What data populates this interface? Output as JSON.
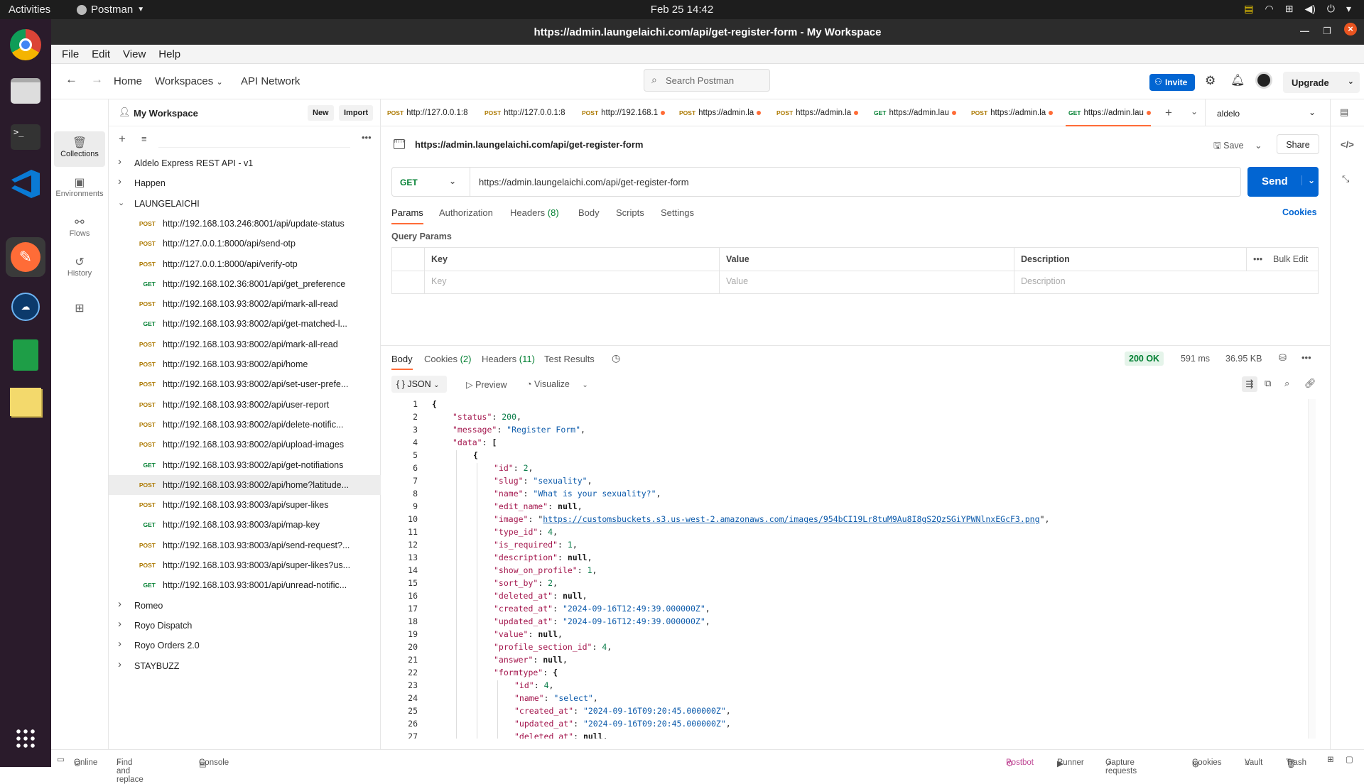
{
  "topbar": {
    "activities": "Activities",
    "app": "Postman",
    "clock": "Feb 25  14:42"
  },
  "window": {
    "title": "https://admin.laungelaichi.com/api/get-register-form - My Workspace"
  },
  "menu": [
    "File",
    "Edit",
    "View",
    "Help"
  ],
  "header": {
    "home": "Home",
    "workspaces": "Workspaces",
    "api_network": "API Network",
    "search_placeholder": "Search Postman",
    "invite": "Invite",
    "upgrade": "Upgrade"
  },
  "rail": [
    {
      "label": "Collections",
      "icon": "collections-icon"
    },
    {
      "label": "Environments",
      "icon": "environments-icon"
    },
    {
      "label": "Flows",
      "icon": "flows-icon"
    },
    {
      "label": "History",
      "icon": "history-icon"
    }
  ],
  "sidebar": {
    "workspace": "My Workspace",
    "new": "New",
    "import": "Import",
    "tree": [
      {
        "type": "folder",
        "name": "Aldelo Express REST API - v1",
        "open": false
      },
      {
        "type": "folder",
        "name": "Happen",
        "open": false
      },
      {
        "type": "folder",
        "name": "LAUNGELAICHI",
        "open": true
      },
      {
        "type": "req",
        "method": "POST",
        "url": "http://192.168.103.246:8001/api/update-status"
      },
      {
        "type": "req",
        "method": "POST",
        "url": "http://127.0.0.1:8000/api/send-otp"
      },
      {
        "type": "req",
        "method": "POST",
        "url": "http://127.0.0.1:8000/api/verify-otp"
      },
      {
        "type": "req",
        "method": "GET",
        "url": "http://192.168.102.36:8001/api/get_preference"
      },
      {
        "type": "req",
        "method": "POST",
        "url": "http://192.168.103.93:8002/api/mark-all-read"
      },
      {
        "type": "req",
        "method": "GET",
        "url": "http://192.168.103.93:8002/api/get-matched-l..."
      },
      {
        "type": "req",
        "method": "POST",
        "url": "http://192.168.103.93:8002/api/mark-all-read"
      },
      {
        "type": "req",
        "method": "POST",
        "url": "http://192.168.103.93:8002/api/home"
      },
      {
        "type": "req",
        "method": "POST",
        "url": "http://192.168.103.93:8002/api/set-user-prefe..."
      },
      {
        "type": "req",
        "method": "POST",
        "url": "http://192.168.103.93:8002/api/user-report"
      },
      {
        "type": "req",
        "method": "POST",
        "url": "http://192.168.103.93:8002/api/delete-notific..."
      },
      {
        "type": "req",
        "method": "POST",
        "url": "http://192.168.103.93:8002/api/upload-images"
      },
      {
        "type": "req",
        "method": "GET",
        "url": "http://192.168.103.93:8002/api/get-notifiations"
      },
      {
        "type": "req",
        "method": "POST",
        "url": "http://192.168.103.93:8002/api/home?latitude...",
        "selected": true
      },
      {
        "type": "req",
        "method": "POST",
        "url": "http://192.168.103.93:8003/api/super-likes"
      },
      {
        "type": "req",
        "method": "GET",
        "url": "http://192.168.103.93:8003/api/map-key"
      },
      {
        "type": "req",
        "method": "POST",
        "url": "http://192.168.103.93:8003/api/send-request?..."
      },
      {
        "type": "req",
        "method": "POST",
        "url": "http://192.168.103.93:8003/api/super-likes?us..."
      },
      {
        "type": "req",
        "method": "GET",
        "url": "http://192.168.103.93:8001/api/unread-notific..."
      },
      {
        "type": "folder",
        "name": "Romeo",
        "open": false
      },
      {
        "type": "folder",
        "name": "Royo Dispatch",
        "open": false
      },
      {
        "type": "folder",
        "name": "Royo Orders 2.0",
        "open": false
      },
      {
        "type": "folder",
        "name": "STAYBUZZ",
        "open": false
      }
    ]
  },
  "tabs": [
    {
      "method": "POST",
      "url": "http://127.0.0.1:8"
    },
    {
      "method": "POST",
      "url": "http://127.0.0.1:8"
    },
    {
      "method": "POST",
      "url": "http://192.168.1",
      "dot": true
    },
    {
      "method": "POST",
      "url": "https://admin.la",
      "dot": true
    },
    {
      "method": "POST",
      "url": "https://admin.la",
      "dot": true
    },
    {
      "method": "GET",
      "url": "https://admin.lau",
      "dot": true
    },
    {
      "method": "POST",
      "url": "https://admin.la",
      "dot": true
    },
    {
      "method": "GET",
      "url": "https://admin.lau",
      "dot": true,
      "active": true
    }
  ],
  "environment": "aldelo",
  "request": {
    "name": "https://admin.laungelaichi.com/api/get-register-form",
    "save": "Save",
    "share": "Share",
    "method": "GET",
    "url": "https://admin.laungelaichi.com/api/get-register-form",
    "send": "Send",
    "subtabs": [
      "Params",
      "Authorization",
      "Headers",
      "Body",
      "Scripts",
      "Settings"
    ],
    "headers_count": "(8)",
    "cookies": "Cookies",
    "query_params": "Query Params",
    "table": {
      "key": "Key",
      "value": "Value",
      "description": "Description",
      "bulk_edit": "Bulk Edit",
      "key_ph": "Key",
      "value_ph": "Value",
      "desc_ph": "Description"
    }
  },
  "response": {
    "tabs": {
      "body": "Body",
      "cookies": "Cookies",
      "cookies_count": "(2)",
      "headers": "Headers",
      "headers_count": "(11)",
      "tests": "Test Results"
    },
    "status": "200 OK",
    "time": "591 ms",
    "size": "36.95 KB",
    "format": "JSON",
    "preview": "Preview",
    "visualize": "Visualize",
    "lines": [
      [
        0,
        "{"
      ],
      [
        1,
        "\"status\": 200,"
      ],
      [
        1,
        "\"message\": \"Register Form\","
      ],
      [
        1,
        "\"data\": ["
      ],
      [
        2,
        "{"
      ],
      [
        3,
        "\"id\": 2,"
      ],
      [
        3,
        "\"slug\": \"sexuality\","
      ],
      [
        3,
        "\"name\": \"What is your sexuality?\","
      ],
      [
        3,
        "\"edit_name\": null,"
      ],
      [
        3,
        "\"image\": \"https://customsbuckets.s3.us-west-2.amazonaws.com/images/954bCI19Lr8tuM9Au8I8gS2QzSGiYPWNlnxEGcF3.png\","
      ],
      [
        3,
        "\"type_id\": 4,"
      ],
      [
        3,
        "\"is_required\": 1,"
      ],
      [
        3,
        "\"description\": null,"
      ],
      [
        3,
        "\"show_on_profile\": 1,"
      ],
      [
        3,
        "\"sort_by\": 2,"
      ],
      [
        3,
        "\"deleted_at\": null,"
      ],
      [
        3,
        "\"created_at\": \"2024-09-16T12:49:39.000000Z\","
      ],
      [
        3,
        "\"updated_at\": \"2024-09-16T12:49:39.000000Z\","
      ],
      [
        3,
        "\"value\": null,"
      ],
      [
        3,
        "\"profile_section_id\": 4,"
      ],
      [
        3,
        "\"answer\": null,"
      ],
      [
        3,
        "\"formtype\": {"
      ],
      [
        4,
        "\"id\": 4,"
      ],
      [
        4,
        "\"name\": \"select\","
      ],
      [
        4,
        "\"created_at\": \"2024-09-16T09:20:45.000000Z\","
      ],
      [
        4,
        "\"updated_at\": \"2024-09-16T09:20:45.000000Z\","
      ],
      [
        4,
        "\"deleted_at\": null,"
      ]
    ]
  },
  "statusbar": {
    "online": "Online",
    "find": "Find and replace",
    "console": "Console",
    "postbot": "Postbot",
    "runner": "Runner",
    "capture": "Capture requests",
    "cookies": "Cookies",
    "vault": "Vault",
    "trash": "Trash"
  }
}
